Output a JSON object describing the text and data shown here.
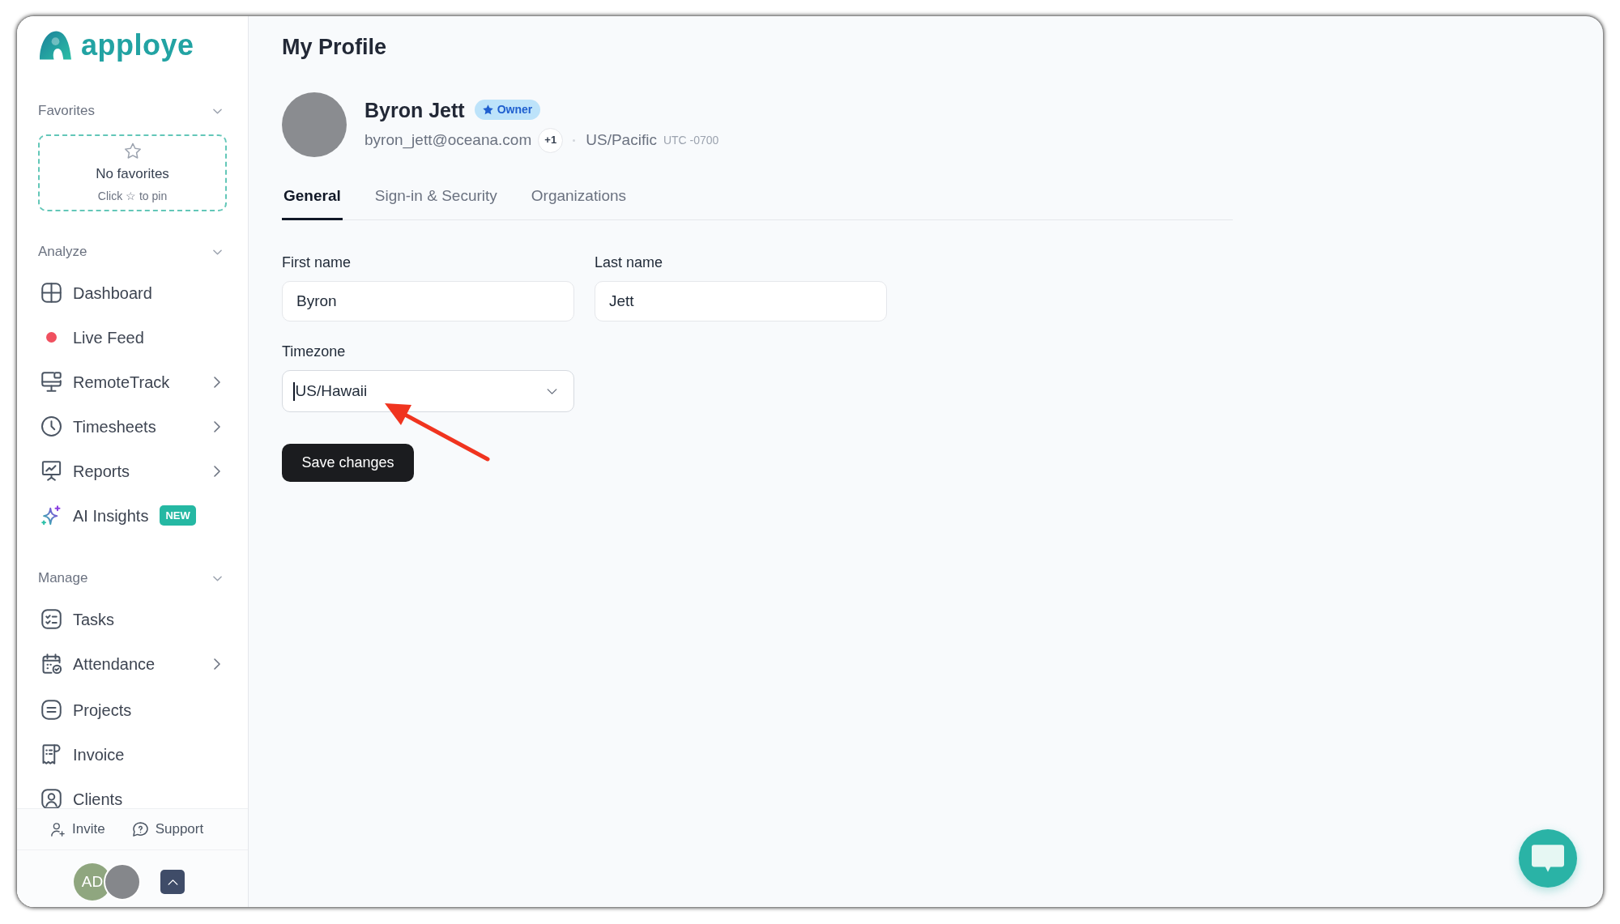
{
  "window": {
    "logo_text": "apploye"
  },
  "sidebar": {
    "sections": [
      {
        "title": "Favorites",
        "expanded": true,
        "empty_state": {
          "title": "No favorites",
          "hint": "Click ☆ to pin"
        }
      },
      {
        "title": "Analyze",
        "expanded": true,
        "groups": [
          [
            {
              "label": "Dashboard",
              "has_submenu": false
            },
            {
              "label": "Live Feed",
              "has_submenu": false
            },
            {
              "label": "RemoteTrack",
              "has_submenu": true
            },
            {
              "label": "Timesheets",
              "has_submenu": true
            },
            {
              "label": "Reports",
              "has_submenu": true
            },
            {
              "label": "AI Insights",
              "has_submenu": false,
              "badge": "NEW"
            }
          ]
        ]
      },
      {
        "title": "Manage",
        "expanded": true,
        "groups": [
          [
            {
              "label": "Tasks",
              "has_submenu": false
            },
            {
              "label": "Attendance",
              "has_submenu": true
            }
          ],
          [
            {
              "label": "Projects",
              "has_submenu": false
            },
            {
              "label": "Invoice",
              "has_submenu": false
            },
            {
              "label": "Clients",
              "has_submenu": false
            }
          ]
        ]
      }
    ],
    "footer_links": [
      {
        "label": "Invite"
      },
      {
        "label": "Support"
      }
    ],
    "user": {
      "initials": "AD"
    }
  },
  "page": {
    "title": "My Profile"
  },
  "profile": {
    "name": "Byron Jett",
    "role": "Owner",
    "email": "byron_jett@oceana.com",
    "extra_emails": "+1",
    "timezone": "US/Pacific",
    "utc_offset": "UTC -0700"
  },
  "tabs": [
    {
      "label": "General",
      "selected": true
    },
    {
      "label": "Sign-in & Security",
      "selected": false
    },
    {
      "label": "Organizations",
      "selected": false
    }
  ],
  "form": {
    "fields": [
      {
        "kind": "text",
        "label": "First name",
        "value": "Byron"
      },
      {
        "kind": "text",
        "label": "Last name",
        "value": "Jett"
      },
      {
        "kind": "select",
        "label": "Timezone",
        "value": "US/Hawaii",
        "focused": true
      }
    ],
    "submit": "Save changes"
  }
}
